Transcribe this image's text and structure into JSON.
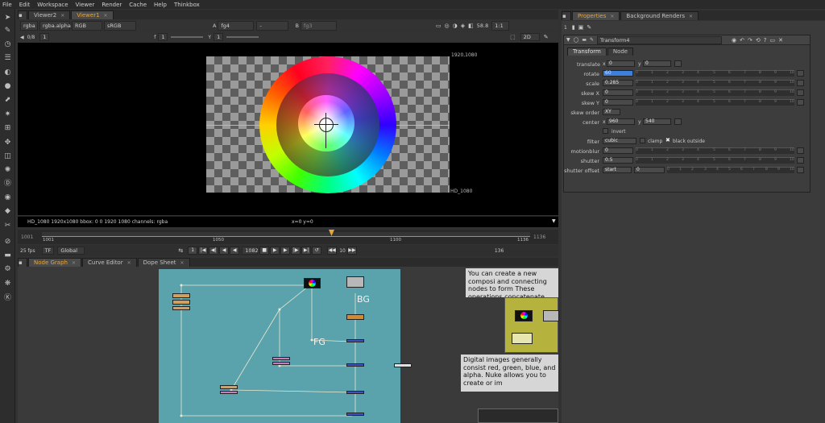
{
  "menu": [
    "File",
    "Edit",
    "Workspace",
    "Viewer",
    "Render",
    "Cache",
    "Help",
    "Thinkbox"
  ],
  "viewer_tabs": [
    {
      "label": "Viewer2",
      "active": false
    },
    {
      "label": "Viewer1",
      "active": true
    }
  ],
  "viewer_controls": {
    "channels": "rgba",
    "alpha": "rgba.alpha",
    "colorspace_a": "RGB",
    "colorspace_b": "sRGB",
    "input_a_label": "A",
    "input_a": "fg4",
    "input_a_op": "-",
    "input_b_label": "B",
    "input_b": "fg3",
    "zoom": "58.8",
    "ratio": "1:1",
    "view_mode": "2D",
    "frame_in": "0/8",
    "frame_val": "1",
    "gain_label": "f",
    "gain": "1",
    "gamma_label": "Y",
    "gamma": "1"
  },
  "viewer": {
    "format_top": "1920,1080",
    "format_bottom": "HD_1080",
    "info_left": "HD_1080 1920x1080  bbox: 0 0 1920 1080 channels: rgba",
    "info_coords": "x=0 y=0"
  },
  "timeline": {
    "start": "1001",
    "marks": [
      "1001",
      "1050",
      "1100",
      "1136"
    ],
    "end": "1136",
    "current": "1082"
  },
  "transport": {
    "fps": "25 fps",
    "tf": "TF",
    "scope": "Global",
    "frame": "1082",
    "step": "10",
    "end": "136"
  },
  "nodegraph_tabs": [
    {
      "label": "Node Graph",
      "active": true
    },
    {
      "label": "Curve Editor",
      "active": false
    },
    {
      "label": "Dope Sheet",
      "active": false
    }
  ],
  "nodegraph": {
    "label_bg": "BG",
    "label_fg": "FG",
    "note1": "You can create a new composi and connecting nodes to form These operations concatenate manipulate your images.",
    "note2": "Digital images generally consist red, green, blue, and alpha. Nuke allows you to create or im"
  },
  "props_tabs": [
    {
      "label": "Properties",
      "active": true
    },
    {
      "label": "Background Renders",
      "active": false
    }
  ],
  "props": {
    "panel_count": "1",
    "node_name": "Transform4",
    "subtabs": [
      {
        "label": "Transform",
        "active": true
      },
      {
        "label": "Node",
        "active": false
      }
    ],
    "fields": {
      "translate_label": "translate",
      "translate_x_label": "x",
      "translate_x": "0",
      "translate_y_label": "y",
      "translate_y": "0",
      "rotate_label": "rotate",
      "rotate": "60",
      "scale_label": "scale",
      "scale": "0.285",
      "skewx_label": "skew X",
      "skewx": "0",
      "skewy_label": "skew Y",
      "skewy": "0",
      "skeworder_label": "skew order",
      "skeworder": "XY",
      "center_label": "center",
      "center_x_label": "x",
      "center_x": "960",
      "center_y_label": "y",
      "center_y": "540",
      "invert_label": "invert",
      "filter_label": "filter",
      "filter": "cubic",
      "clamp_label": "clamp",
      "black_outside_label": "black outside",
      "motionblur_label": "motionblur",
      "motionblur": "0",
      "shutter_label": "shutter",
      "shutter": "0.5",
      "shutteroffset_label": "shutter offset",
      "shutteroffset": "start",
      "shutteroffset_val": "0"
    },
    "slider_ticks": [
      "0",
      "1",
      "2",
      "3",
      "4",
      "5",
      "6",
      "7",
      "8",
      "9",
      "10"
    ]
  },
  "colors": {
    "accent": "#e8a53a",
    "backdrop": "#5aa3ad",
    "rotate_field": "#3d7fd9"
  }
}
